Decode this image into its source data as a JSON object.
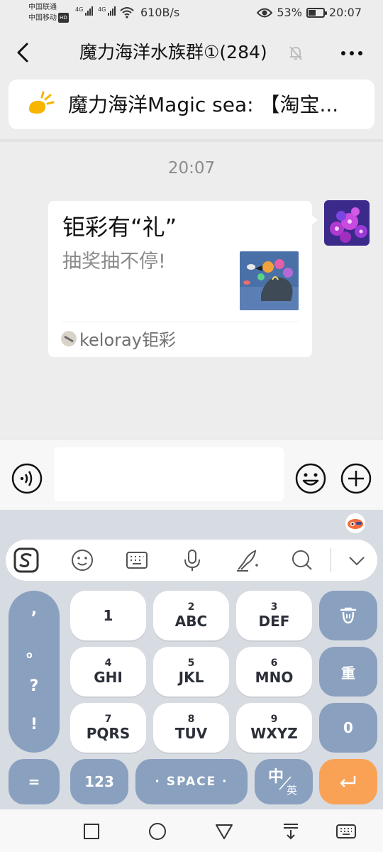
{
  "status_bar": {
    "carrier_1": "中国联通",
    "carrier_2": "中国移动",
    "hd_badge": "HD",
    "net_1": "4G",
    "net_2": "4G",
    "net_speed": "610B/s",
    "battery": "53%",
    "battery_level": 0.53,
    "time": "20:07"
  },
  "header": {
    "title": "魔力海洋水族群①(284)",
    "muted": true
  },
  "announcement": {
    "text": "魔力海洋Magic sea: 【淘宝..."
  },
  "chat": {
    "timestamp": "20:07",
    "message": {
      "title": "钜彩有“礼”",
      "description": "抽奖抽不停!",
      "source": "keloray钜彩"
    }
  },
  "input": {
    "value": "",
    "placeholder": ""
  },
  "keyboard": {
    "punctuation": [
      ",",
      "。",
      "?",
      "!"
    ],
    "keys": [
      {
        "number": "",
        "letters": "1"
      },
      {
        "number": "2",
        "letters": "ABC"
      },
      {
        "number": "3",
        "letters": "DEF"
      },
      {
        "number": "4",
        "letters": "GHI"
      },
      {
        "number": "5",
        "letters": "JKL"
      },
      {
        "number": "6",
        "letters": "MNO"
      },
      {
        "number": "7",
        "letters": "PQRS"
      },
      {
        "number": "8",
        "letters": "TUV"
      },
      {
        "number": "9",
        "letters": "WXYZ"
      }
    ],
    "redo_label": "重",
    "zero_label": "0",
    "equals_label": "=",
    "num_switch_label": "123",
    "space_label": "· SPACE ·",
    "lang_main": "中",
    "lang_sub": "英"
  },
  "colors": {
    "key_blue": "#8aa0bf",
    "enter_orange": "#f9a255",
    "keyboard_bg": "#d7dbe2",
    "chat_bg": "#ededed"
  },
  "icons": {
    "back": "chevron-left-icon",
    "mute": "bell-off-icon",
    "more": "more-icon",
    "voice": "voice-icon",
    "emoji": "emoji-icon",
    "plus": "plus-icon"
  }
}
